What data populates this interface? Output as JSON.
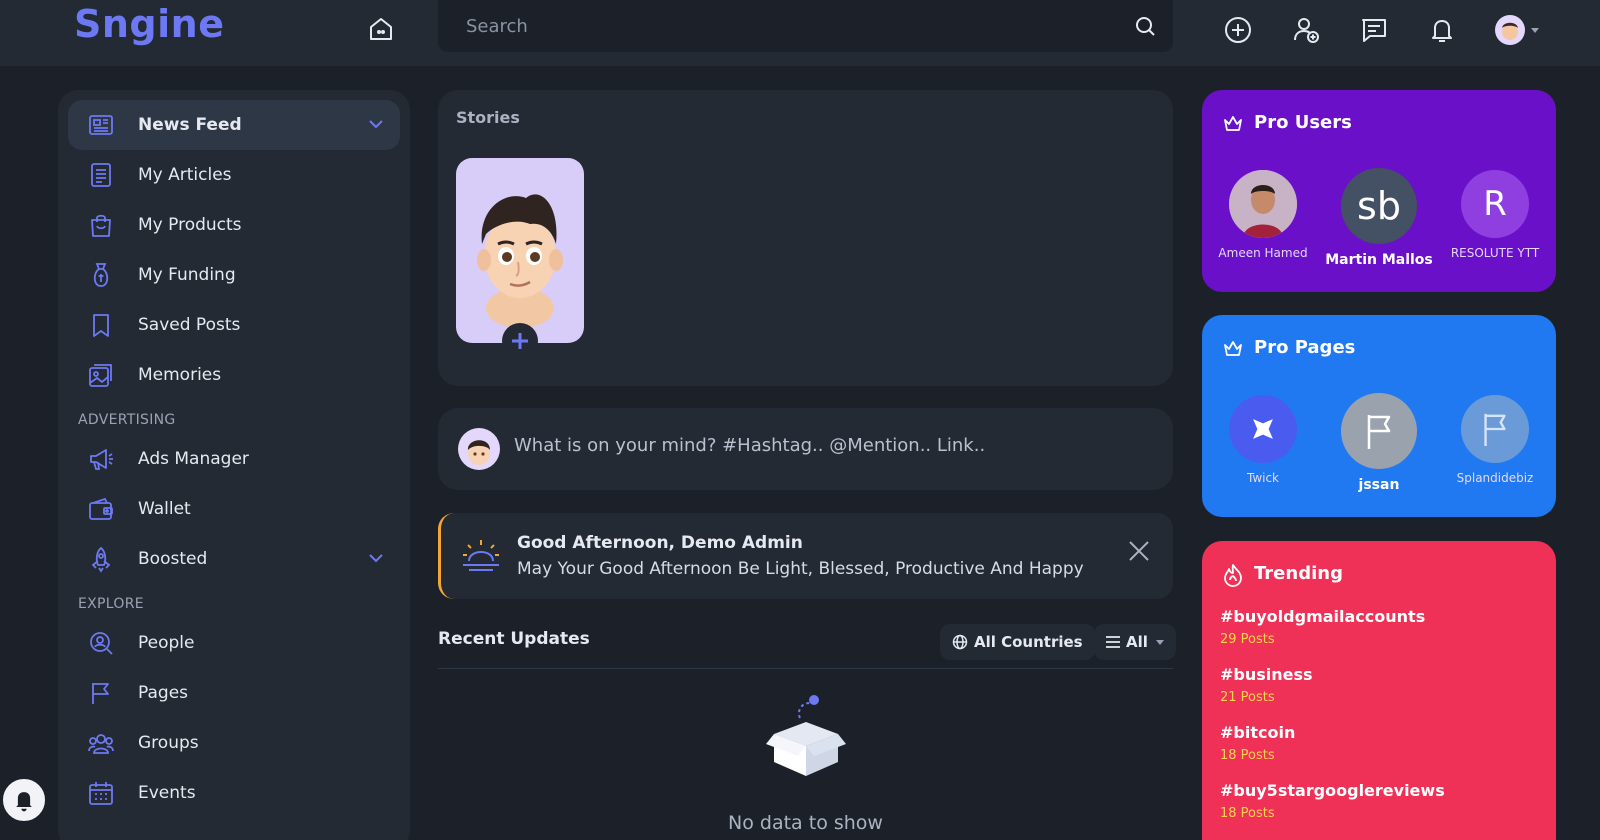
{
  "app": {
    "logo": "Sngine"
  },
  "search": {
    "placeholder": "Search"
  },
  "sidebar": {
    "items": [
      {
        "label": "News Feed",
        "icon": "newspaper-icon"
      },
      {
        "label": "My Articles",
        "icon": "article-icon"
      },
      {
        "label": "My Products",
        "icon": "shopping-bag-icon"
      },
      {
        "label": "My Funding",
        "icon": "funding-icon"
      },
      {
        "label": "Saved Posts",
        "icon": "bookmark-icon"
      },
      {
        "label": "Memories",
        "icon": "photos-icon"
      }
    ],
    "advertising_header": "ADVERTISING",
    "advertising": [
      {
        "label": "Ads Manager",
        "icon": "megaphone-icon"
      },
      {
        "label": "Wallet",
        "icon": "wallet-icon"
      },
      {
        "label": "Boosted",
        "icon": "rocket-icon"
      }
    ],
    "explore_header": "EXPLORE",
    "explore": [
      {
        "label": "People",
        "icon": "people-search-icon"
      },
      {
        "label": "Pages",
        "icon": "flag-icon"
      },
      {
        "label": "Groups",
        "icon": "groups-icon"
      },
      {
        "label": "Events",
        "icon": "calendar-icon"
      }
    ]
  },
  "stories": {
    "title": "Stories"
  },
  "composer": {
    "placeholder": "What is on your mind? #Hashtag.. @Mention.. Link.."
  },
  "greeting": {
    "title": "Good Afternoon, Demo Admin",
    "message": "May Your Good Afternoon Be Light, Blessed, Productive And Happy"
  },
  "recent": {
    "title": "Recent Updates",
    "country_filter": "All Countries",
    "type_filter": "All",
    "empty_text": "No data to show"
  },
  "pro_users": {
    "title": "Pro Users",
    "users": [
      {
        "name": "Ameen Hamed",
        "initials": ""
      },
      {
        "name": "Martin Mallos",
        "initials": "sb"
      },
      {
        "name": "RESOLUTE YTT",
        "initials": "R"
      }
    ]
  },
  "pro_pages": {
    "title": "Pro Pages",
    "pages": [
      {
        "name": "Twick"
      },
      {
        "name": "jssan"
      },
      {
        "name": "Splandidebiz"
      }
    ]
  },
  "trending": {
    "title": "Trending",
    "items": [
      {
        "tag": "#buyoldgmailaccounts",
        "count": "29 Posts"
      },
      {
        "tag": "#business",
        "count": "21 Posts"
      },
      {
        "tag": "#bitcoin",
        "count": "18 Posts"
      },
      {
        "tag": "#buy5stargooglereviews",
        "count": "18 Posts"
      }
    ]
  },
  "colors": {
    "background": "#1c2129",
    "card": "#232a34",
    "accent": "#6d79f2",
    "pro_users_bg": "#6a10c9",
    "pro_pages_bg": "#2079f0",
    "trending_bg": "#ef3157",
    "trend_count": "#ffd64a"
  }
}
